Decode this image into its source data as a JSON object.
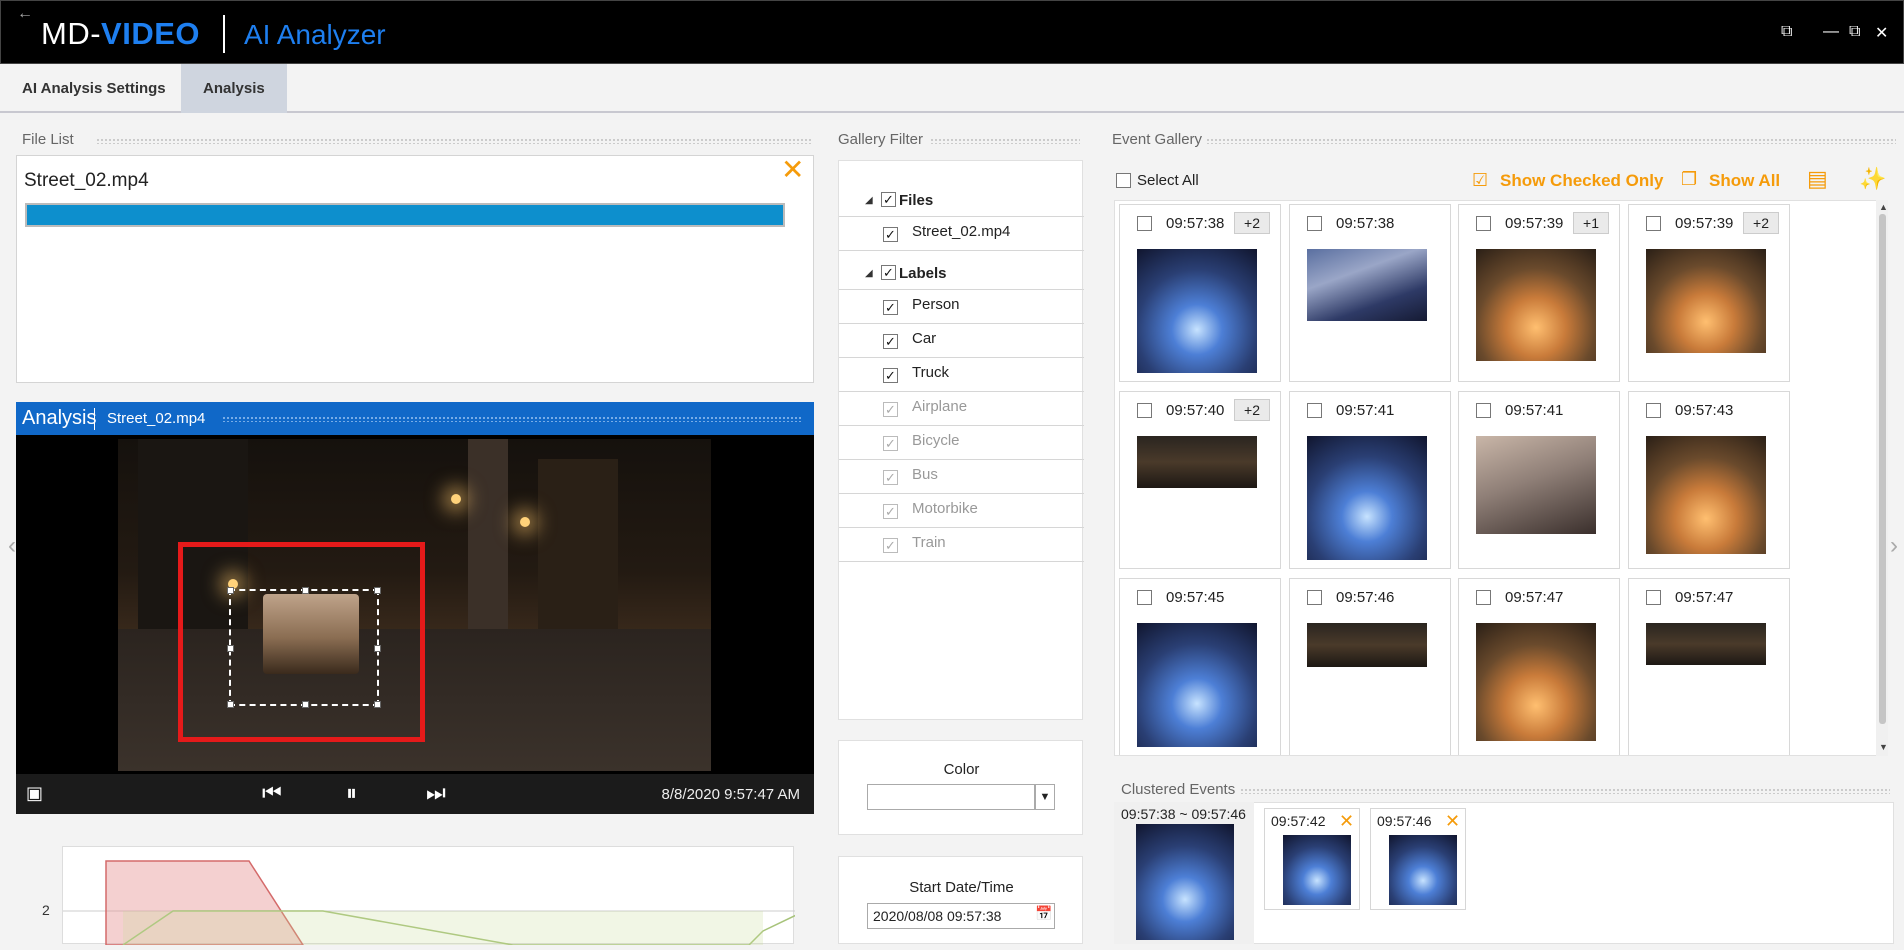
{
  "window": {
    "brand_prefix": "MD-",
    "brand_name": "VIDEO",
    "app_title": "AI Analyzer",
    "back_icon": "arrow-left-icon",
    "controls": [
      "restore-icon",
      "minimize-icon",
      "maximize-icon",
      "close-icon"
    ]
  },
  "tabs": [
    {
      "label": "AI Analysis Settings",
      "active": false
    },
    {
      "label": "Analysis",
      "active": true
    }
  ],
  "file_list": {
    "title": "File List",
    "files": [
      {
        "name": "Street_02.mp4",
        "progress_percent": 100
      }
    ]
  },
  "analysis": {
    "title": "Analysis",
    "file": "Street_02.mp4",
    "timestamp": "8/8/2020 9:57:47 AM"
  },
  "chart": {
    "y_tick": "2"
  },
  "gallery_filter": {
    "title": "Gallery Filter",
    "files_header": "Files",
    "files": [
      "Street_02.mp4"
    ],
    "labels_header": "Labels",
    "labels": [
      {
        "name": "Person",
        "checked": true,
        "enabled": true
      },
      {
        "name": "Car",
        "checked": true,
        "enabled": true
      },
      {
        "name": "Truck",
        "checked": true,
        "enabled": true
      },
      {
        "name": "Airplane",
        "checked": true,
        "enabled": false
      },
      {
        "name": "Bicycle",
        "checked": true,
        "enabled": false
      },
      {
        "name": "Bus",
        "checked": true,
        "enabled": false
      },
      {
        "name": "Motorbike",
        "checked": true,
        "enabled": false
      },
      {
        "name": "Train",
        "checked": true,
        "enabled": false
      }
    ],
    "color_label": "Color",
    "color_value": "",
    "start_label": "Start Date/Time",
    "start_value": "2020/08/08 09:57:38"
  },
  "event_gallery": {
    "title": "Event Gallery",
    "select_all": "Select All",
    "show_checked_only": "Show Checked Only",
    "show_all": "Show All",
    "events": [
      {
        "time": "09:57:38",
        "extra": "+2",
        "style": "blue"
      },
      {
        "time": "09:57:38",
        "extra": "",
        "style": "default"
      },
      {
        "time": "09:57:39",
        "extra": "+1",
        "style": "orange"
      },
      {
        "time": "09:57:39",
        "extra": "+2",
        "style": "orange"
      },
      {
        "time": "09:57:40",
        "extra": "+2",
        "style": "dark"
      },
      {
        "time": "09:57:41",
        "extra": "",
        "style": "blue"
      },
      {
        "time": "09:57:41",
        "extra": "",
        "style": "pale"
      },
      {
        "time": "09:57:43",
        "extra": "",
        "style": "orange"
      },
      {
        "time": "09:57:45",
        "extra": "",
        "style": "blue"
      },
      {
        "time": "09:57:46",
        "extra": "",
        "style": "dark"
      },
      {
        "time": "09:57:47",
        "extra": "",
        "style": "orange"
      },
      {
        "time": "09:57:47",
        "extra": "",
        "style": "dark"
      }
    ]
  },
  "clustered_events": {
    "title": "Clustered Events",
    "items": [
      {
        "label": "09:57:38 ~ 09:57:46",
        "removable": false
      },
      {
        "label": "09:57:42",
        "removable": true
      },
      {
        "label": "09:57:46",
        "removable": true
      }
    ]
  },
  "colors": {
    "accent_blue": "#1e7ff0",
    "header_blue": "#1068c8",
    "orange": "#f59b0a",
    "detection_red": "#e51a1a",
    "progress": "#0d8fcd"
  }
}
